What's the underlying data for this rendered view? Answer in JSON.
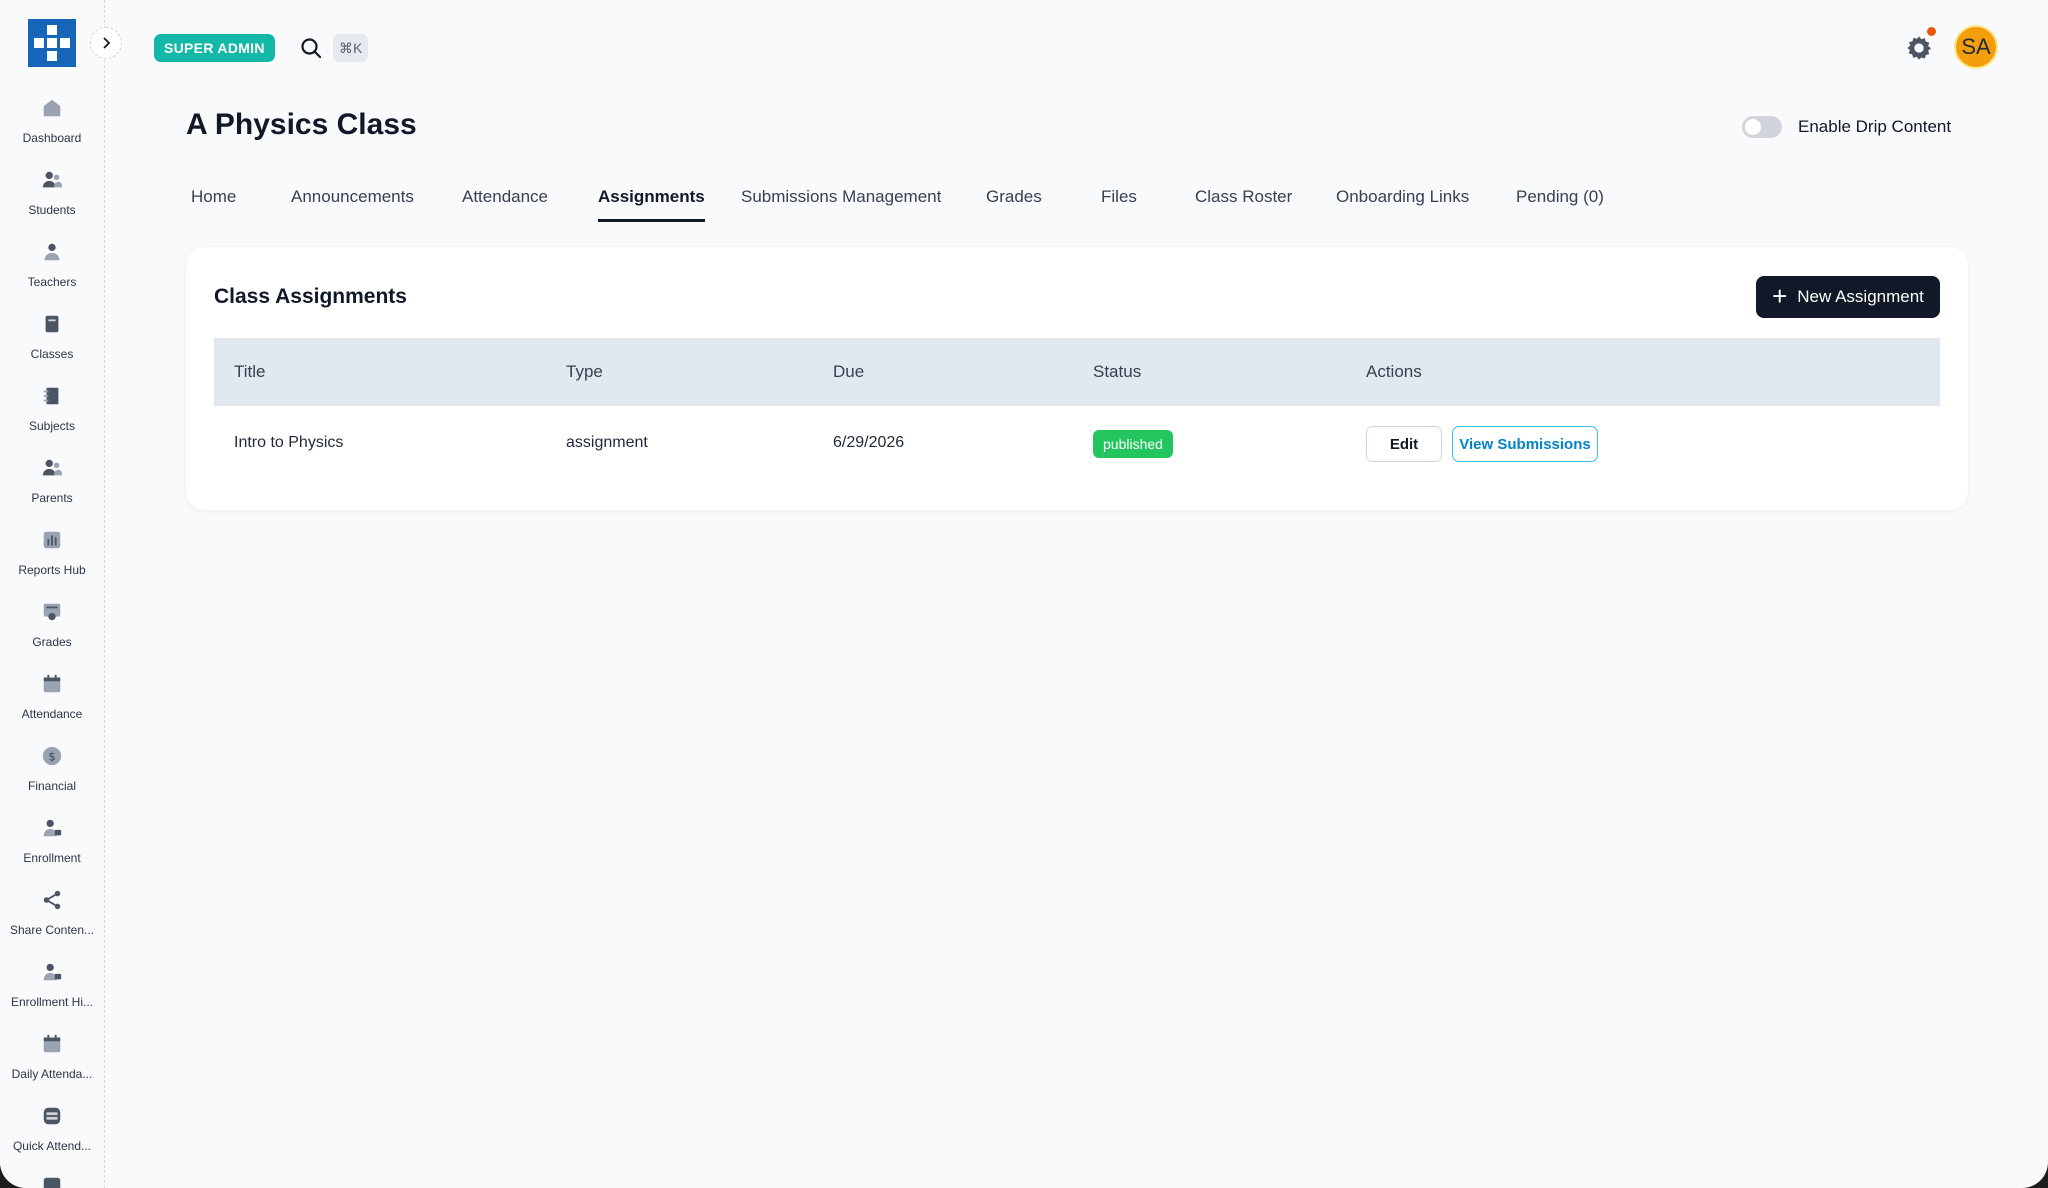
{
  "sidebar": {
    "items": [
      {
        "label": "Dashboard",
        "icon": "home-icon"
      },
      {
        "label": "Students",
        "icon": "students-icon"
      },
      {
        "label": "Teachers",
        "icon": "teacher-icon"
      },
      {
        "label": "Classes",
        "icon": "book-icon"
      },
      {
        "label": "Subjects",
        "icon": "notebook-icon"
      },
      {
        "label": "Parents",
        "icon": "parents-icon"
      },
      {
        "label": "Reports Hub",
        "icon": "bar-chart-icon"
      },
      {
        "label": "Grades",
        "icon": "grades-icon"
      },
      {
        "label": "Attendance",
        "icon": "calendar-icon"
      },
      {
        "label": "Financial",
        "icon": "dollar-icon"
      },
      {
        "label": "Enrollment",
        "icon": "user-plus-icon"
      },
      {
        "label": "Share Conten...",
        "icon": "share-icon"
      },
      {
        "label": "Enrollment Hi...",
        "icon": "user-history-icon"
      },
      {
        "label": "Daily Attenda...",
        "icon": "calendar-icon"
      },
      {
        "label": "Quick Attend...",
        "icon": "quick-attendance-icon"
      }
    ]
  },
  "topbar": {
    "role_badge": "SUPER ADMIN",
    "search_shortcut": "⌘K",
    "avatar_initials": "SA"
  },
  "header": {
    "title": "A Physics Class",
    "drip_toggle_label": "Enable Drip Content"
  },
  "tabs": [
    {
      "label": "Home",
      "active": false
    },
    {
      "label": "Announcements",
      "active": false
    },
    {
      "label": "Attendance",
      "active": false
    },
    {
      "label": "Assignments",
      "active": true
    },
    {
      "label": "Submissions Management",
      "active": false
    },
    {
      "label": "Grades",
      "active": false
    },
    {
      "label": "Files",
      "active": false
    },
    {
      "label": "Class Roster",
      "active": false
    },
    {
      "label": "Onboarding Links",
      "active": false
    },
    {
      "label": "Pending (0)",
      "active": false
    }
  ],
  "assignments": {
    "title": "Class Assignments",
    "new_button_label": "New Assignment",
    "columns": [
      "Title",
      "Type",
      "Due",
      "Status",
      "Actions"
    ],
    "rows": [
      {
        "title": "Intro to Physics",
        "type": "assignment",
        "due": "6/29/2026",
        "status": "published",
        "edit_label": "Edit",
        "view_label": "View Submissions"
      }
    ]
  },
  "colors": {
    "brand": "#1665b8",
    "badge": "#14b8a6",
    "published": "#22c55e",
    "primary_button": "#111827",
    "avatar": "#f59e0b",
    "notification": "#ea580c"
  }
}
